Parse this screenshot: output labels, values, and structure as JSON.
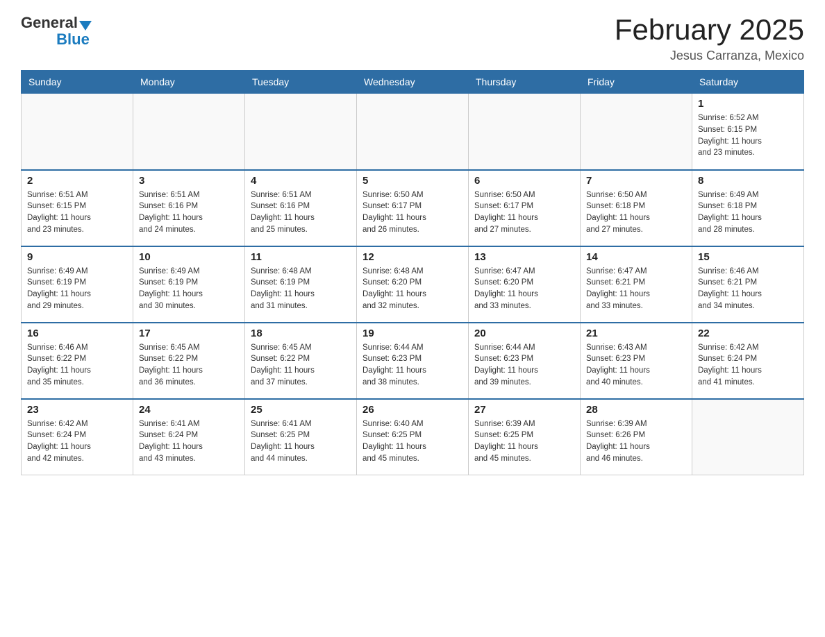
{
  "header": {
    "logo_general": "General",
    "logo_blue": "Blue",
    "month_title": "February 2025",
    "location": "Jesus Carranza, Mexico"
  },
  "days_of_week": [
    "Sunday",
    "Monday",
    "Tuesday",
    "Wednesday",
    "Thursday",
    "Friday",
    "Saturday"
  ],
  "weeks": [
    {
      "days": [
        {
          "num": "",
          "info": ""
        },
        {
          "num": "",
          "info": ""
        },
        {
          "num": "",
          "info": ""
        },
        {
          "num": "",
          "info": ""
        },
        {
          "num": "",
          "info": ""
        },
        {
          "num": "",
          "info": ""
        },
        {
          "num": "1",
          "info": "Sunrise: 6:52 AM\nSunset: 6:15 PM\nDaylight: 11 hours\nand 23 minutes."
        }
      ]
    },
    {
      "days": [
        {
          "num": "2",
          "info": "Sunrise: 6:51 AM\nSunset: 6:15 PM\nDaylight: 11 hours\nand 23 minutes."
        },
        {
          "num": "3",
          "info": "Sunrise: 6:51 AM\nSunset: 6:16 PM\nDaylight: 11 hours\nand 24 minutes."
        },
        {
          "num": "4",
          "info": "Sunrise: 6:51 AM\nSunset: 6:16 PM\nDaylight: 11 hours\nand 25 minutes."
        },
        {
          "num": "5",
          "info": "Sunrise: 6:50 AM\nSunset: 6:17 PM\nDaylight: 11 hours\nand 26 minutes."
        },
        {
          "num": "6",
          "info": "Sunrise: 6:50 AM\nSunset: 6:17 PM\nDaylight: 11 hours\nand 27 minutes."
        },
        {
          "num": "7",
          "info": "Sunrise: 6:50 AM\nSunset: 6:18 PM\nDaylight: 11 hours\nand 27 minutes."
        },
        {
          "num": "8",
          "info": "Sunrise: 6:49 AM\nSunset: 6:18 PM\nDaylight: 11 hours\nand 28 minutes."
        }
      ]
    },
    {
      "days": [
        {
          "num": "9",
          "info": "Sunrise: 6:49 AM\nSunset: 6:19 PM\nDaylight: 11 hours\nand 29 minutes."
        },
        {
          "num": "10",
          "info": "Sunrise: 6:49 AM\nSunset: 6:19 PM\nDaylight: 11 hours\nand 30 minutes."
        },
        {
          "num": "11",
          "info": "Sunrise: 6:48 AM\nSunset: 6:19 PM\nDaylight: 11 hours\nand 31 minutes."
        },
        {
          "num": "12",
          "info": "Sunrise: 6:48 AM\nSunset: 6:20 PM\nDaylight: 11 hours\nand 32 minutes."
        },
        {
          "num": "13",
          "info": "Sunrise: 6:47 AM\nSunset: 6:20 PM\nDaylight: 11 hours\nand 33 minutes."
        },
        {
          "num": "14",
          "info": "Sunrise: 6:47 AM\nSunset: 6:21 PM\nDaylight: 11 hours\nand 33 minutes."
        },
        {
          "num": "15",
          "info": "Sunrise: 6:46 AM\nSunset: 6:21 PM\nDaylight: 11 hours\nand 34 minutes."
        }
      ]
    },
    {
      "days": [
        {
          "num": "16",
          "info": "Sunrise: 6:46 AM\nSunset: 6:22 PM\nDaylight: 11 hours\nand 35 minutes."
        },
        {
          "num": "17",
          "info": "Sunrise: 6:45 AM\nSunset: 6:22 PM\nDaylight: 11 hours\nand 36 minutes."
        },
        {
          "num": "18",
          "info": "Sunrise: 6:45 AM\nSunset: 6:22 PM\nDaylight: 11 hours\nand 37 minutes."
        },
        {
          "num": "19",
          "info": "Sunrise: 6:44 AM\nSunset: 6:23 PM\nDaylight: 11 hours\nand 38 minutes."
        },
        {
          "num": "20",
          "info": "Sunrise: 6:44 AM\nSunset: 6:23 PM\nDaylight: 11 hours\nand 39 minutes."
        },
        {
          "num": "21",
          "info": "Sunrise: 6:43 AM\nSunset: 6:23 PM\nDaylight: 11 hours\nand 40 minutes."
        },
        {
          "num": "22",
          "info": "Sunrise: 6:42 AM\nSunset: 6:24 PM\nDaylight: 11 hours\nand 41 minutes."
        }
      ]
    },
    {
      "days": [
        {
          "num": "23",
          "info": "Sunrise: 6:42 AM\nSunset: 6:24 PM\nDaylight: 11 hours\nand 42 minutes."
        },
        {
          "num": "24",
          "info": "Sunrise: 6:41 AM\nSunset: 6:24 PM\nDaylight: 11 hours\nand 43 minutes."
        },
        {
          "num": "25",
          "info": "Sunrise: 6:41 AM\nSunset: 6:25 PM\nDaylight: 11 hours\nand 44 minutes."
        },
        {
          "num": "26",
          "info": "Sunrise: 6:40 AM\nSunset: 6:25 PM\nDaylight: 11 hours\nand 45 minutes."
        },
        {
          "num": "27",
          "info": "Sunrise: 6:39 AM\nSunset: 6:25 PM\nDaylight: 11 hours\nand 45 minutes."
        },
        {
          "num": "28",
          "info": "Sunrise: 6:39 AM\nSunset: 6:26 PM\nDaylight: 11 hours\nand 46 minutes."
        },
        {
          "num": "",
          "info": ""
        }
      ]
    }
  ]
}
